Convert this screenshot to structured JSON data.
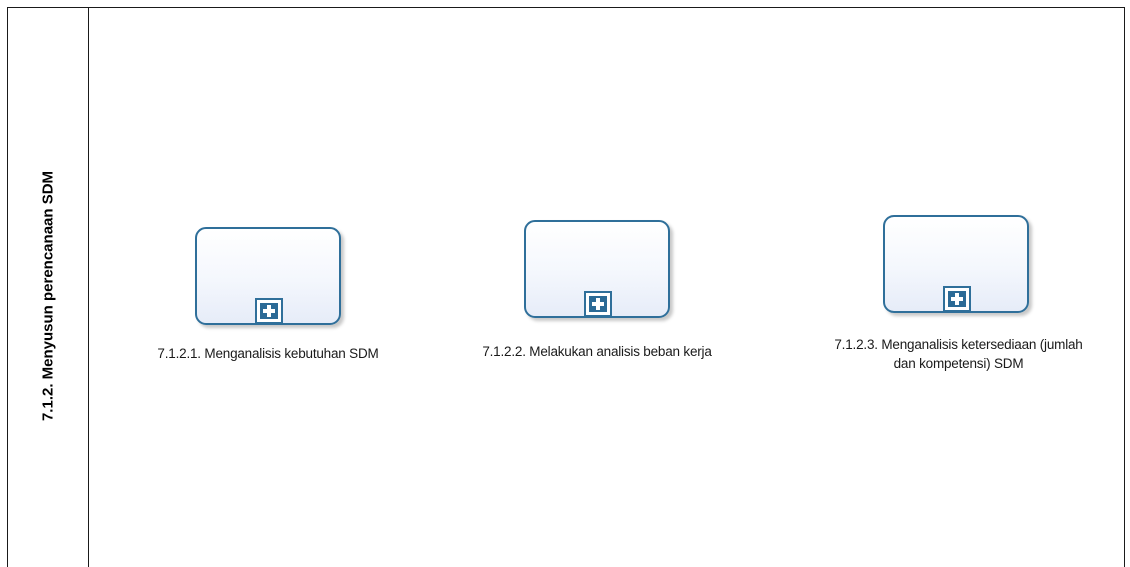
{
  "diagram": {
    "pool": {
      "title": "7.1.2. Menyusun perencanaan SDM"
    },
    "tasks": [
      {
        "label": "7.1.2.1. Menganalisis kebutuhan SDM",
        "marker": "expand-plus-icon"
      },
      {
        "label": "7.1.2.2. Melakukan analisis beban kerja",
        "marker": "expand-plus-icon"
      },
      {
        "label": "7.1.2.3. Menganalisis ketersediaan (jumlah dan kompetensi) SDM",
        "marker": "expand-plus-icon"
      }
    ],
    "colors": {
      "task_border": "#2f6f9a",
      "marker_fill": "#2b6a96",
      "pool_border": "#1a1a1a"
    }
  }
}
